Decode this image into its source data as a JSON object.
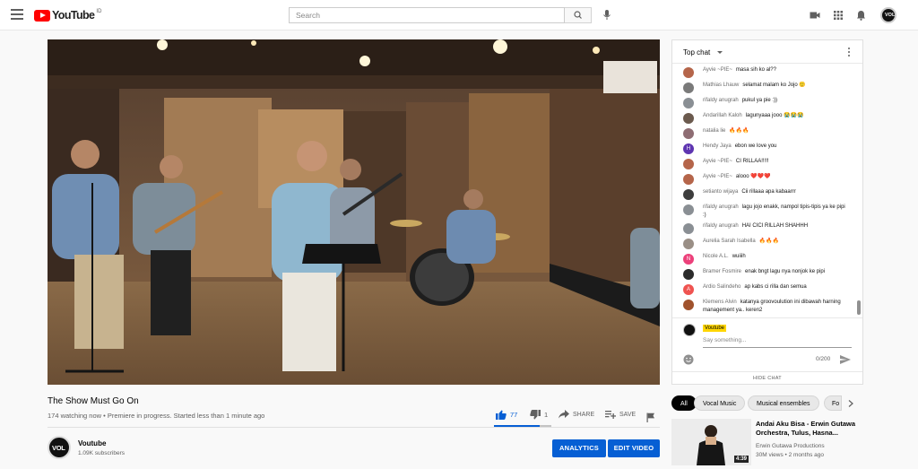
{
  "header": {
    "logo_text": "YouTube",
    "country_code": "ID",
    "search_placeholder": "Search"
  },
  "video": {
    "title": "The Show Must Go On",
    "meta": "174 watching now • Premiere in progress. Started less than 1 minute ago",
    "likes": "77",
    "dislikes": "1",
    "like_ratio": 0.8,
    "share_label": "SHARE",
    "save_label": "SAVE"
  },
  "channel": {
    "avatar_text": "VOL",
    "name": "Voutube",
    "subscribers": "1.09K subscribers",
    "analytics_label": "ANALYTICS",
    "edit_label": "EDIT VIDEO"
  },
  "chat": {
    "header": "Top chat",
    "messages": [
      {
        "author": "Ayvie ~PIE~",
        "text": "masa sih ko al??",
        "color": "#b5654a"
      },
      {
        "author": "Mathias Lhauw",
        "text": "selamat malam ko Jojo 🙂",
        "color": "#7a7a7a"
      },
      {
        "author": "rifaldy anugrah",
        "text": "pukul ya pie :))",
        "color": "#8a8f94"
      },
      {
        "author": "Andarillah Kaloh",
        "text": "lagunyaaa jooo 😭😭😭",
        "color": "#6b5a4e"
      },
      {
        "author": "natalia lie",
        "text": "🔥🔥🔥",
        "color": "#8e6d73"
      },
      {
        "author": "Hendy Jaya",
        "text": "ebon we love you",
        "color": "#5e35b1"
      },
      {
        "author": "Ayvie ~PIE~",
        "text": "CI RILLAA!!!!!",
        "color": "#b5654a"
      },
      {
        "author": "Ayvie ~PIE~",
        "text": "alooo ❤️❤️❤️",
        "color": "#b5654a"
      },
      {
        "author": "setianto wijaya",
        "text": "Cii rillaaa apa kabaarrr",
        "color": "#3d3d3d"
      },
      {
        "author": "rifaldy anugrah",
        "text": "lagu jojo enakk, nampol tipis-tipis ya ke pipi :)",
        "color": "#8a8f94"
      },
      {
        "author": "rifaldy anugrah",
        "text": "HAI CICI RILLAH SHAHHH",
        "color": "#8a8f94"
      },
      {
        "author": "Aurelia Sarah Isabella",
        "text": "🔥🔥🔥",
        "color": "#9a8f86"
      },
      {
        "author": "Nicole A.L.",
        "text": "wuiiih",
        "color": "#ec407a"
      },
      {
        "author": "Bramer Fosmire",
        "text": "enak bngt lagu nya nonjok ke pipi",
        "color": "#2b2b2b"
      },
      {
        "author": "Ardio Salindeho",
        "text": "ap kabs ci rilla dan semua",
        "color": "#ef5350"
      },
      {
        "author": "Klemens Alvin",
        "text": "katanya groovoulution ini dibawah harning management ya.. keren2",
        "color": "#a0522d"
      }
    ],
    "me_name": "Voutube",
    "input_placeholder": "Say something...",
    "counter": "0/200",
    "hide_label": "HIDE CHAT"
  },
  "chips": [
    "All",
    "Vocal Music",
    "Musical ensembles",
    "Fo"
  ],
  "related": {
    "title": "Andai Aku Bisa - Erwin Gutawa Orchestra, Tulus, Hasna...",
    "channel": "Erwin Gutawa Productions",
    "views": "30M views • 2 months ago",
    "duration": "4:39"
  },
  "colors": {
    "accent": "#065fd4",
    "brand_red": "#ff0000"
  }
}
